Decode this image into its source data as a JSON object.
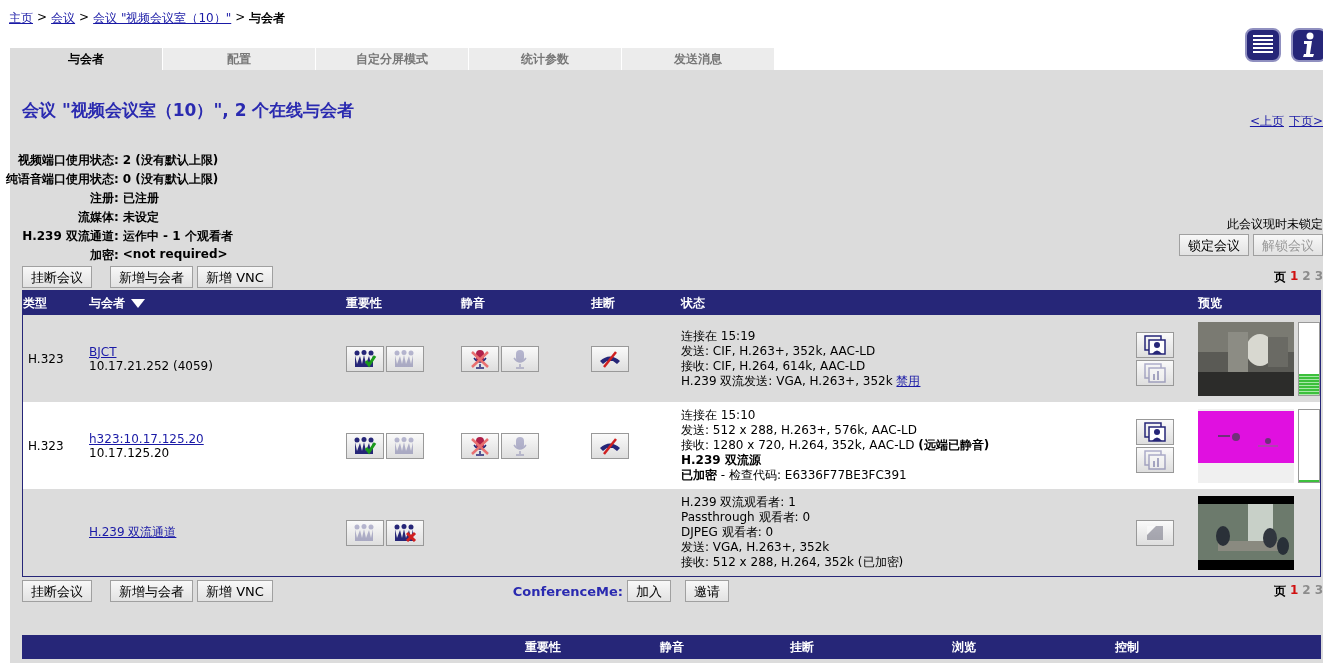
{
  "breadcrumb": {
    "links": [
      "主页",
      "会议",
      "会议 \"视频会议室（10）\""
    ],
    "separator": ">",
    "current": "与会者"
  },
  "tabs": [
    {
      "label": "与会者",
      "selected": true
    },
    {
      "label": "配置",
      "selected": false
    },
    {
      "label": "自定分屏模式",
      "selected": false
    },
    {
      "label": "统计参数",
      "selected": false
    },
    {
      "label": "发送消息",
      "selected": false
    }
  ],
  "heading": "会议 \"视频会议室（10）\", 2 个在线与会者",
  "pager": {
    "previous": "<上页",
    "next": "下页>"
  },
  "info": [
    {
      "label": "视频端口使用状态:",
      "value": "2 (没有默认上限)"
    },
    {
      "label": "纯语音端口使用状态:",
      "value": "0 (没有默认上限)"
    },
    {
      "label": "注册:",
      "value": "已注册"
    },
    {
      "label": "流媒体:",
      "value": "未设定"
    },
    {
      "label": "H.239 双流通道:",
      "value": "运作中 - 1 个观看者"
    },
    {
      "label": "加密:",
      "value": "<not required>"
    }
  ],
  "lock": {
    "status": "此会议现时未锁定",
    "buttons": [
      {
        "label": "锁定会议",
        "disabled": false
      },
      {
        "label": "解锁会议",
        "disabled": true
      }
    ]
  },
  "top_bar": {
    "actions": [
      "挂断会议",
      "新增与会者",
      "新增 VNC"
    ],
    "pages": {
      "label": "页",
      "items": [
        {
          "label": "1",
          "selected": true
        },
        {
          "label": "2",
          "selected": false
        },
        {
          "label": "3",
          "selected": false
        }
      ]
    }
  },
  "table": {
    "columns": [
      "类型",
      "与会者",
      "重要性",
      "静音",
      "挂断",
      "状态",
      "预览"
    ],
    "rows": [
      {
        "kind": "participant",
        "type": "H.323",
        "name": "BJCT",
        "address": "10.17.21.252 (4059)",
        "important": false,
        "muted": false,
        "status": [
          {
            "text": "连接在 15:19"
          },
          {
            "text": "发送: CIF, H.263+, 352k, AAC-LD"
          },
          {
            "text": "接收: CIF, H.264, 614k, AAC-LD"
          },
          {
            "text": "H.239 双流发送: VGA, H.263+, 352k",
            "link": "禁用"
          }
        ],
        "preview": {
          "kind": "picture"
        },
        "level": 0.28
      },
      {
        "kind": "participant",
        "type": "H.323",
        "name": "h323:10.17.125.20",
        "address": "10.17.125.20",
        "important": false,
        "muted": false,
        "status": [
          {
            "text": "连接在 15:10"
          },
          {
            "text": "发送: 512 x 288, H.263+, 576k, AAC-LD"
          },
          {
            "text": "接收: 1280 x 720, H.264, 352k, AAC-LD **(远端已静音)**"
          },
          {
            "text": "H.239 双流源",
            "bold": true
          },
          {
            "text": "**已加密** - 检查代码: E6336F77BE3FC391"
          }
        ],
        "preview": {
          "kind": "picture"
        },
        "level": 0.02
      },
      {
        "kind": "channel",
        "name": "H.239 双流通道",
        "important": true,
        "status": [
          {
            "text": "H.239 双流观看者: 1"
          },
          {
            "text": "Passthrough 观看者: 0"
          },
          {
            "text": "DJPEG 观看者: 0"
          },
          {
            "text": "发送: VGA, H.263+, 352k"
          },
          {
            "text": "接收: 512 x 288, H.264, 352k (已加密)"
          }
        ],
        "preview": {
          "kind": "picture"
        }
      }
    ]
  },
  "bottom_bar": {
    "actions": [
      "挂断会议",
      "新增与会者",
      "新增 VNC"
    ],
    "conference_me": {
      "label": "ConferenceMe:",
      "buttons": [
        "加入",
        "邀请"
      ]
    },
    "pages": {
      "label": "页",
      "items": [
        {
          "label": "1",
          "selected": true
        },
        {
          "label": "2",
          "selected": false
        },
        {
          "label": "3",
          "selected": false
        }
      ]
    }
  },
  "second_table": {
    "columns": [
      "重要性",
      "静音",
      "挂断",
      "浏览",
      "控制"
    ]
  }
}
